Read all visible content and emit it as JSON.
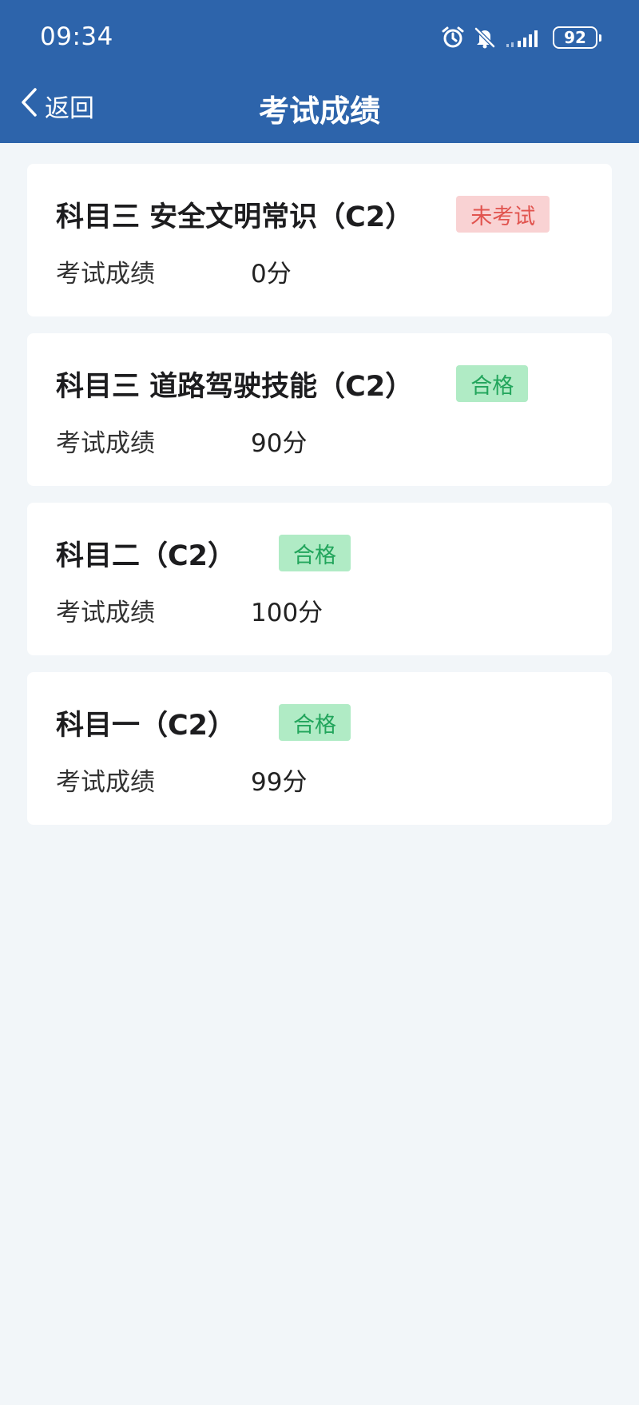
{
  "status_bar": {
    "time": "09:34",
    "icons": [
      "alarm-icon",
      "notifications-off-icon",
      "signal-icon"
    ],
    "battery": "92"
  },
  "header": {
    "back_label": "返回",
    "title": "考试成绩"
  },
  "colors": {
    "header_bg": "#2d64ab",
    "page_bg": "#f2f6f9",
    "fail_badge_bg": "#f9d2d3",
    "fail_badge_text": "#e1544f",
    "pass_badge_bg": "#b0ebc5",
    "pass_badge_text": "#22a55c"
  },
  "results": [
    {
      "title": "科目三 安全文明常识（C2）",
      "badge": "未考试",
      "status": "fail",
      "score_label": "考试成绩",
      "score": "0分"
    },
    {
      "title": "科目三 道路驾驶技能（C2）",
      "badge": "合格",
      "status": "pass",
      "score_label": "考试成绩",
      "score": "90分"
    },
    {
      "title": "科目二（C2）",
      "badge": "合格",
      "status": "pass",
      "score_label": "考试成绩",
      "score": "100分"
    },
    {
      "title": "科目一（C2）",
      "badge": "合格",
      "status": "pass",
      "score_label": "考试成绩",
      "score": "99分"
    }
  ]
}
